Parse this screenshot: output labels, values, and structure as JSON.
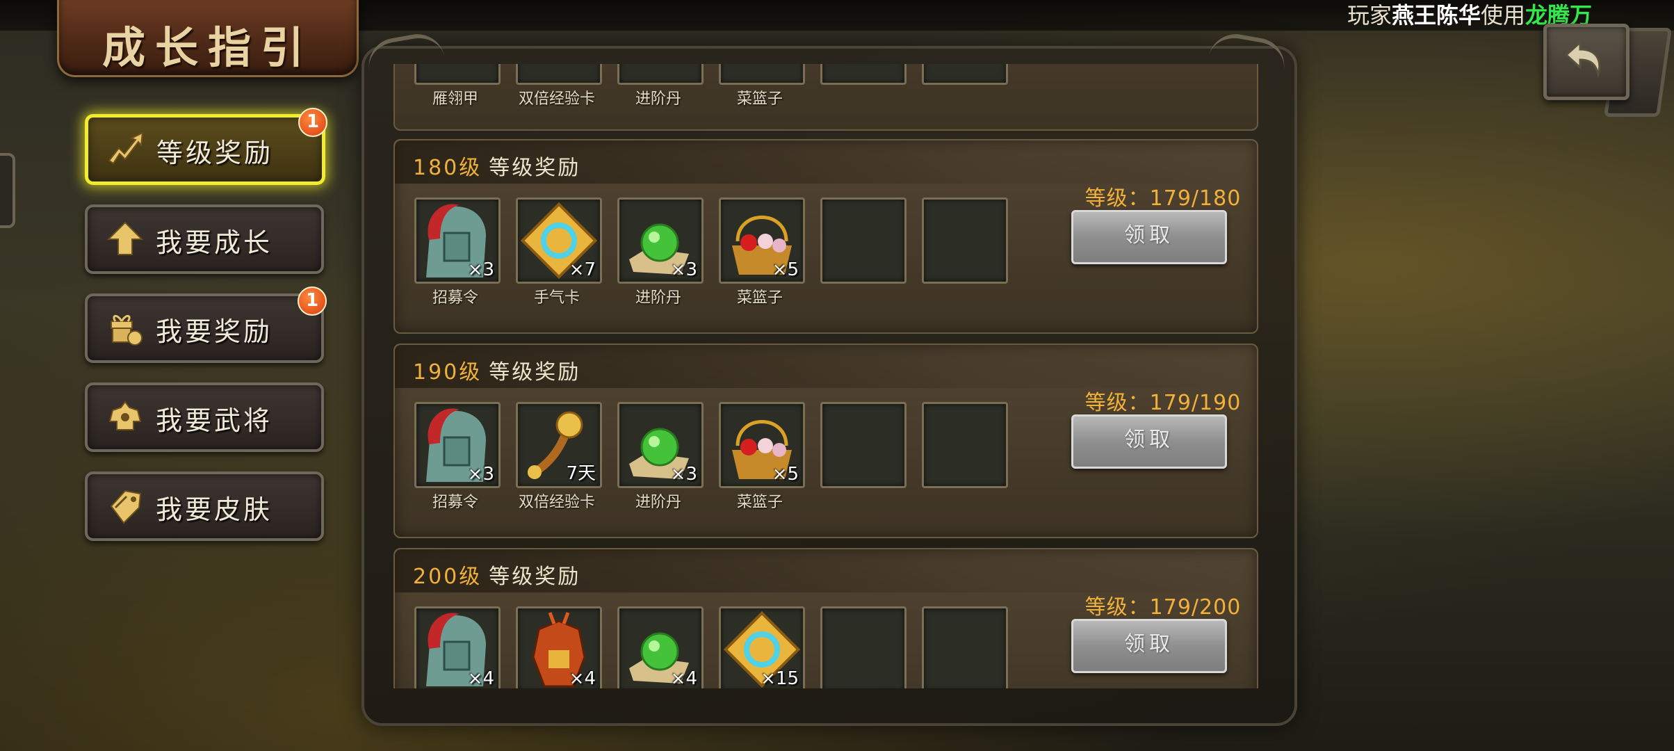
{
  "marquee": {
    "prefix": "玩家",
    "player": "燕王陈华",
    "middle": "使用",
    "item": "龙腾万"
  },
  "title": "成长指引",
  "nav": [
    {
      "label": "等级奖励",
      "icon": "level-up-arrow-icon",
      "active": true,
      "badge": "1"
    },
    {
      "label": "我要成长",
      "icon": "up-arrow-icon",
      "active": false
    },
    {
      "label": "我要奖励",
      "icon": "gift-icon",
      "active": false,
      "badge": "1"
    },
    {
      "label": "我要武将",
      "icon": "general-helmet-icon",
      "active": false
    },
    {
      "label": "我要皮肤",
      "icon": "skin-tag-icon",
      "active": false
    }
  ],
  "prev_card": {
    "items": [
      {
        "name": "雁翎甲"
      },
      {
        "name": "双倍经验卡"
      },
      {
        "name": "进阶丹"
      },
      {
        "name": "菜篮子"
      }
    ]
  },
  "cards": [
    {
      "level": "180级",
      "title": "等级奖励",
      "status_label": "等级：",
      "status_value": "179/180",
      "button": "领取",
      "items": [
        {
          "name": "招募令",
          "qty": "×3",
          "icon": "recruit-token-icon"
        },
        {
          "name": "手气卡",
          "qty": "×7",
          "icon": "luck-card-icon"
        },
        {
          "name": "进阶丹",
          "qty": "×3",
          "icon": "green-pill-icon"
        },
        {
          "name": "菜篮子",
          "qty": "×5",
          "icon": "flower-basket-icon"
        }
      ]
    },
    {
      "level": "190级",
      "title": "等级奖励",
      "status_label": "等级：",
      "status_value": "179/190",
      "button": "领取",
      "items": [
        {
          "name": "招募令",
          "qty": "×3",
          "icon": "recruit-token-icon"
        },
        {
          "name": "双倍经验卡",
          "qty": "7天",
          "icon": "ruyi-scepter-icon"
        },
        {
          "name": "进阶丹",
          "qty": "×3",
          "icon": "green-pill-icon"
        },
        {
          "name": "菜篮子",
          "qty": "×5",
          "icon": "flower-basket-icon"
        }
      ]
    },
    {
      "level": "200级",
      "title": "等级奖励",
      "status_label": "等级：",
      "status_value": "179/200",
      "button": "领取",
      "items": [
        {
          "name": "",
          "qty": "×4",
          "icon": "recruit-token-icon"
        },
        {
          "name": "",
          "qty": "×4",
          "icon": "armor-icon"
        },
        {
          "name": "",
          "qty": "×4",
          "icon": "green-pill-icon"
        },
        {
          "name": "",
          "qty": "×15",
          "icon": "luck-card-icon"
        }
      ]
    }
  ]
}
